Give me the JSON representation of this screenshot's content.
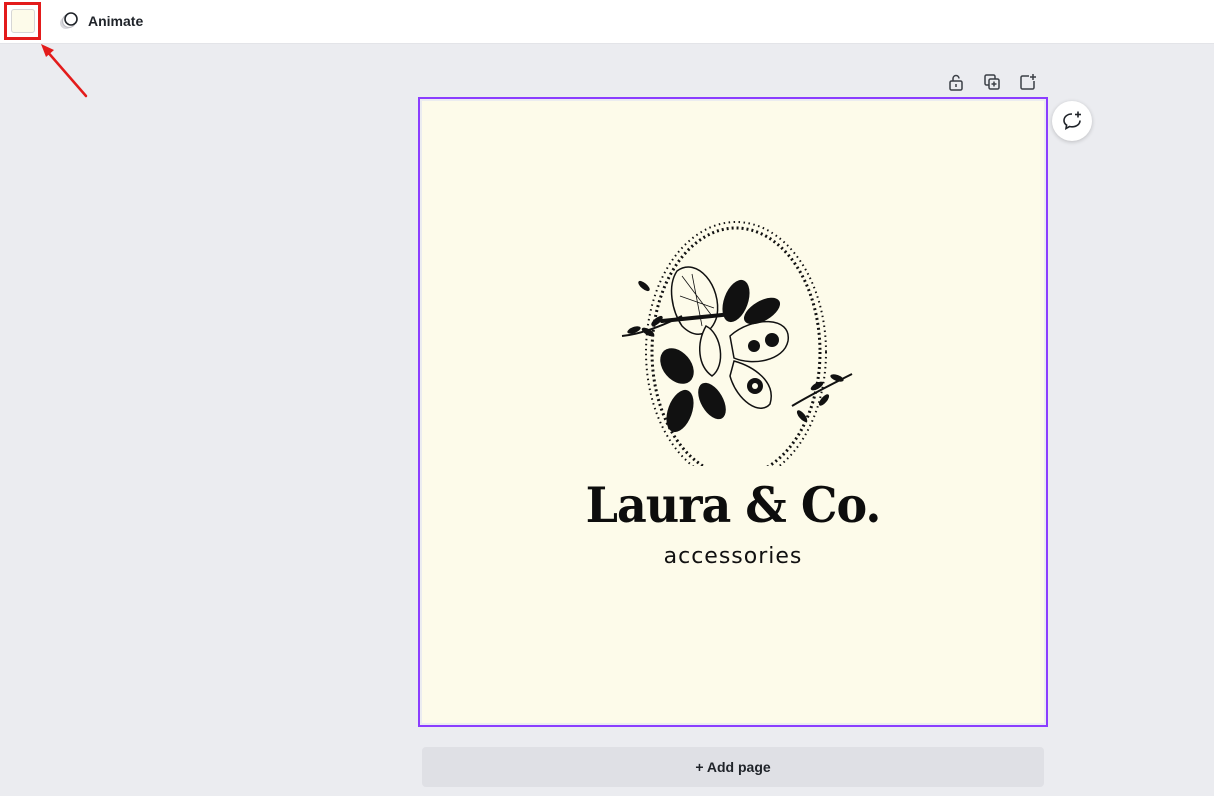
{
  "toolbar": {
    "background_color": "#fdfbea",
    "animate_label": "Animate"
  },
  "page_tools": {
    "icons": [
      "unlock-icon",
      "duplicate-page-icon",
      "add-page-icon"
    ]
  },
  "design": {
    "background_color": "#fdfbea",
    "brand_name": "Laura & Co.",
    "tagline": "accessories"
  },
  "comment": {
    "icon": "add-comment-icon"
  },
  "footer": {
    "add_page_label": "+ Add page"
  },
  "colors": {
    "selection": "#8b3dff",
    "annotation": "#e31b1b",
    "workspace": "#ebecf0"
  }
}
